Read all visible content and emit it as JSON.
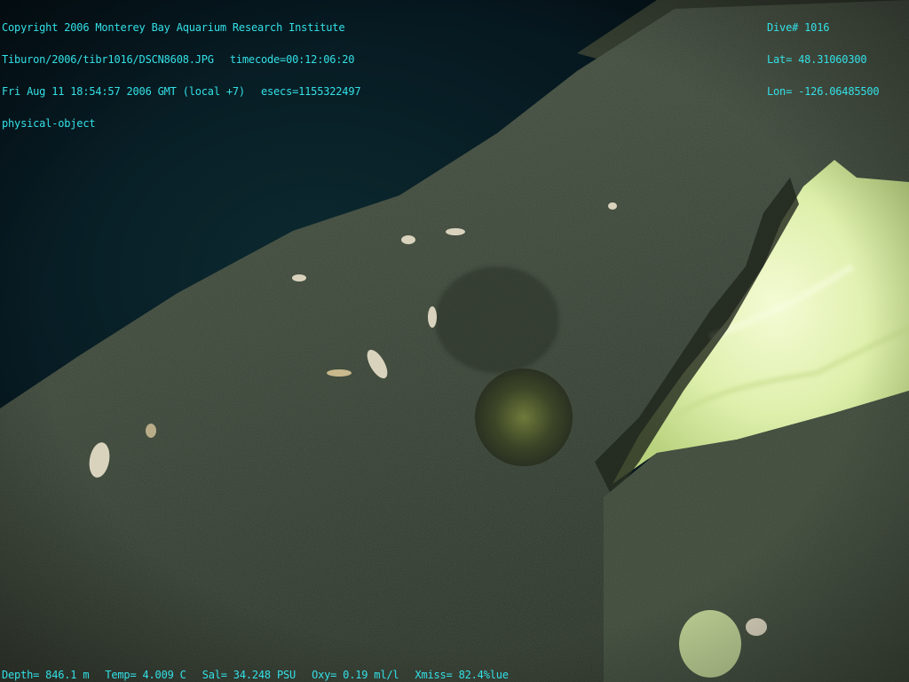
{
  "overlay": {
    "top_left": {
      "line1": "Copyright 2006 Monterey Bay Aquarium Research Institute",
      "path": "Tiburon/2006/tibr1016/DSCN8608.JPG",
      "timecode": "timecode=00:12:06:20",
      "datetime": "Fri Aug 11 18:54:57 2006 GMT (local +7)",
      "esecs": "esecs=1155322497",
      "category": "physical-object"
    },
    "top_right": {
      "dive": "Dive# 1016",
      "lat": "Lat= 48.31060300",
      "lon": "Lon= -126.06485500"
    },
    "bottom": {
      "depth": "Depth= 846.1 m",
      "temp": "Temp= 4.009 C",
      "sal": "Sal= 34.248 PSU",
      "oxy": "Oxy= 0.19 ml/l",
      "xmiss": "Xmiss= 82.4%lue"
    },
    "text_color": "#33e0e6"
  },
  "scene": {
    "water_color": "#071a20",
    "sediment_color": "#3a4536",
    "hydrate_color": "#e6f5b8"
  }
}
